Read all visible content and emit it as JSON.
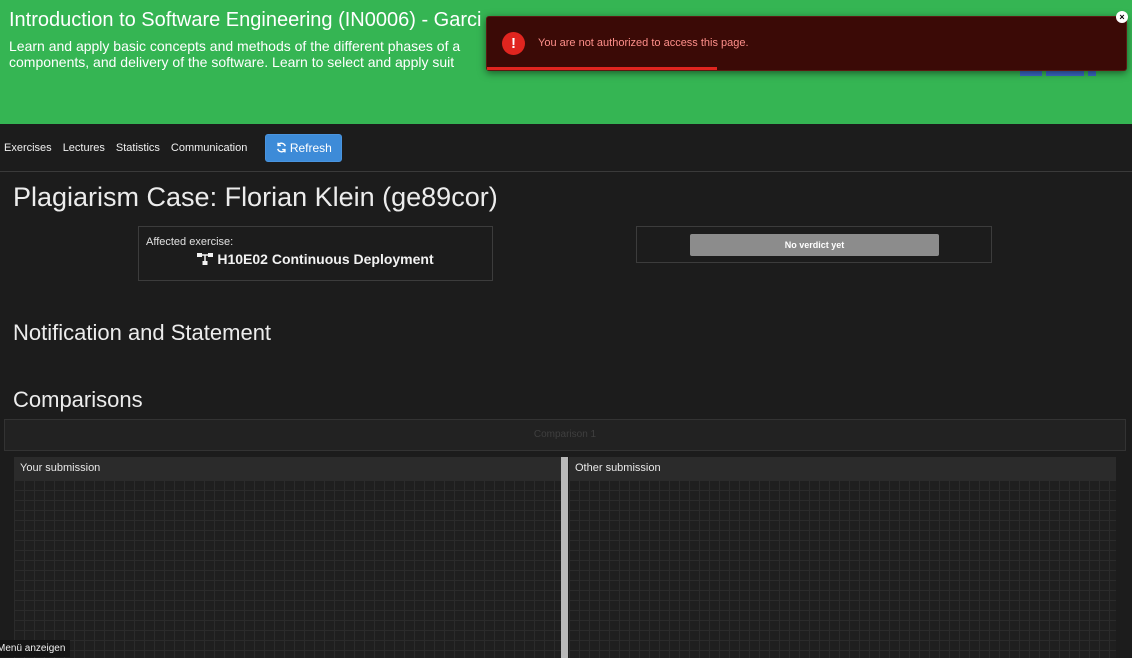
{
  "course": {
    "title": "Introduction to Software Engineering (IN0006) - Garci",
    "description_line1": "Learn and apply basic concepts and methods of the different phases of a",
    "description_line2": "components, and delivery of the software. Learn to select and apply suit"
  },
  "toast": {
    "icon": "!",
    "message": "You are not authorized to access this page.",
    "close_icon": "×",
    "progress": 0.36
  },
  "nav": {
    "items": [
      "Exercises",
      "Lectures",
      "Statistics",
      "Communication"
    ],
    "refresh_label": "Refresh"
  },
  "case": {
    "title": "Plagiarism Case: Florian Klein (ge89cor)",
    "affected_label": "Affected exercise:",
    "exercise_name": "H10E02 Continuous Deployment",
    "verdict": "No verdict yet"
  },
  "sections": {
    "notification": "Notification and Statement",
    "comparisons": "Comparisons"
  },
  "comparison": {
    "tab_label": "Comparison 1",
    "left_title": "Your submission",
    "right_title": "Other submission"
  },
  "menu_toggle": "Menü anzeigen",
  "colors": {
    "header_green": "#35b553",
    "toast_bg": "#3b0a06",
    "toast_accent": "#e0251f",
    "refresh_blue": "#3d8bd8",
    "verdict_gray": "#8c8c8c"
  },
  "icons": {
    "refresh": "refresh-icon",
    "exercise": "programming-exercise-icon",
    "toast": "error-icon",
    "close": "close-icon"
  }
}
